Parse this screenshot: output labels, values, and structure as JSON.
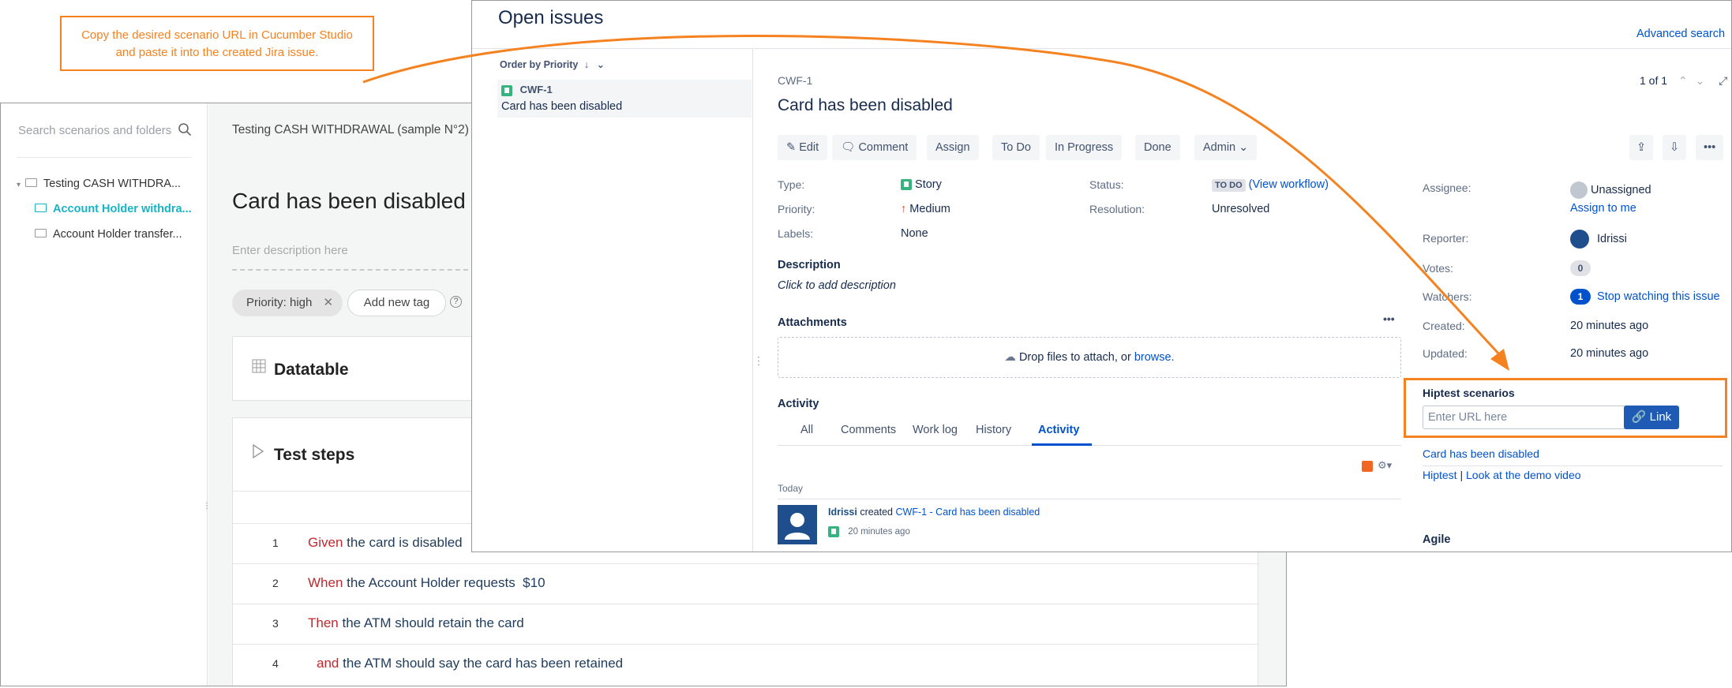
{
  "callout": {
    "line1": "Copy the desired scenario URL in Cucumber Studio",
    "line2": "and paste it into the created Jira issue."
  },
  "cucumber": {
    "search_placeholder": "Search scenarios and folders",
    "tree": [
      {
        "label": "Testing CASH WITHDRA...",
        "color": "#333333"
      },
      {
        "label": "Account Holder withdra...",
        "color": "#18b3c4"
      },
      {
        "label": "Account Holder transfer...",
        "color": "#333333"
      }
    ],
    "breadcrumb": "Testing CASH WITHDRAWAL (sample N°2)",
    "breadcrumb_sep": "/",
    "title": "Card has been disabled",
    "description_placeholder": "Enter description here",
    "tag_priority": "Priority: high",
    "tag_add": "Add new tag",
    "datatable_title": "Datatable",
    "steps_title": "Test steps",
    "steps": [
      {
        "num": "1",
        "keyword": "Given",
        "text": "the card is disabled"
      },
      {
        "num": "2",
        "keyword": "When",
        "text": "the Account Holder requests  $10"
      },
      {
        "num": "3",
        "keyword": "Then",
        "text": "the ATM should retain the card"
      },
      {
        "num": "4",
        "keyword": "and",
        "text": "the ATM should say the card has been retained"
      }
    ]
  },
  "jira": {
    "heading": "Open issues",
    "advanced_search": "Advanced search",
    "order_by": "Order by Priority",
    "list_item_key": "CWF-1",
    "list_item_title": "Card has been disabled",
    "issue_key": "CWF-1",
    "issue_title": "Card has been disabled",
    "pager": "1 of 1",
    "buttons": {
      "edit": "Edit",
      "comment": "Comment",
      "assign": "Assign",
      "todo": "To Do",
      "in_progress": "In Progress",
      "done": "Done",
      "admin": "Admin"
    },
    "fields": {
      "type_label": "Type:",
      "type_value": "Story",
      "priority_label": "Priority:",
      "priority_value": "Medium",
      "labels_label": "Labels:",
      "labels_value": "None",
      "status_label": "Status:",
      "status_value": "TO DO",
      "status_link": "(View workflow)",
      "resolution_label": "Resolution:",
      "resolution_value": "Unresolved"
    },
    "description_heading": "Description",
    "description_placeholder": "Click to add description",
    "attachments_heading": "Attachments",
    "drop_text": "Drop files to attach, or",
    "drop_link": "browse.",
    "activity_heading": "Activity",
    "tabs": [
      "All",
      "Comments",
      "Work log",
      "History",
      "Activity"
    ],
    "today": "Today",
    "activity_user": "Idrissi",
    "activity_verb": "created",
    "activity_link": "CWF-1 - Card has been disabled",
    "activity_time": "20 minutes ago",
    "people": {
      "assignee_label": "Assignee:",
      "assignee_value": "Unassigned",
      "assign_to_me": "Assign to me",
      "reporter_label": "Reporter:",
      "reporter_value": "Idrissi",
      "votes_label": "Votes:",
      "votes_value": "0",
      "watchers_label": "Watchers:",
      "watchers_value": "1",
      "stop_watching": "Stop watching this issue",
      "created_label": "Created:",
      "created_value": "20 minutes ago",
      "updated_label": "Updated:",
      "updated_value": "20 minutes ago"
    },
    "hiptest": {
      "heading": "Hiptest scenarios",
      "input_placeholder": "Enter URL here",
      "link_button": "Link",
      "linked_scenario": "Card has been disabled",
      "footer_link1": "Hiptest",
      "footer_sep": "|",
      "footer_link2": "Look at the demo video"
    },
    "agile_heading": "Agile"
  },
  "colors": {
    "accent_orange": "#f58220",
    "jira_blue": "#0052cc",
    "gherkin_keyword": "#c0282d",
    "story_green": "#36b37e"
  }
}
